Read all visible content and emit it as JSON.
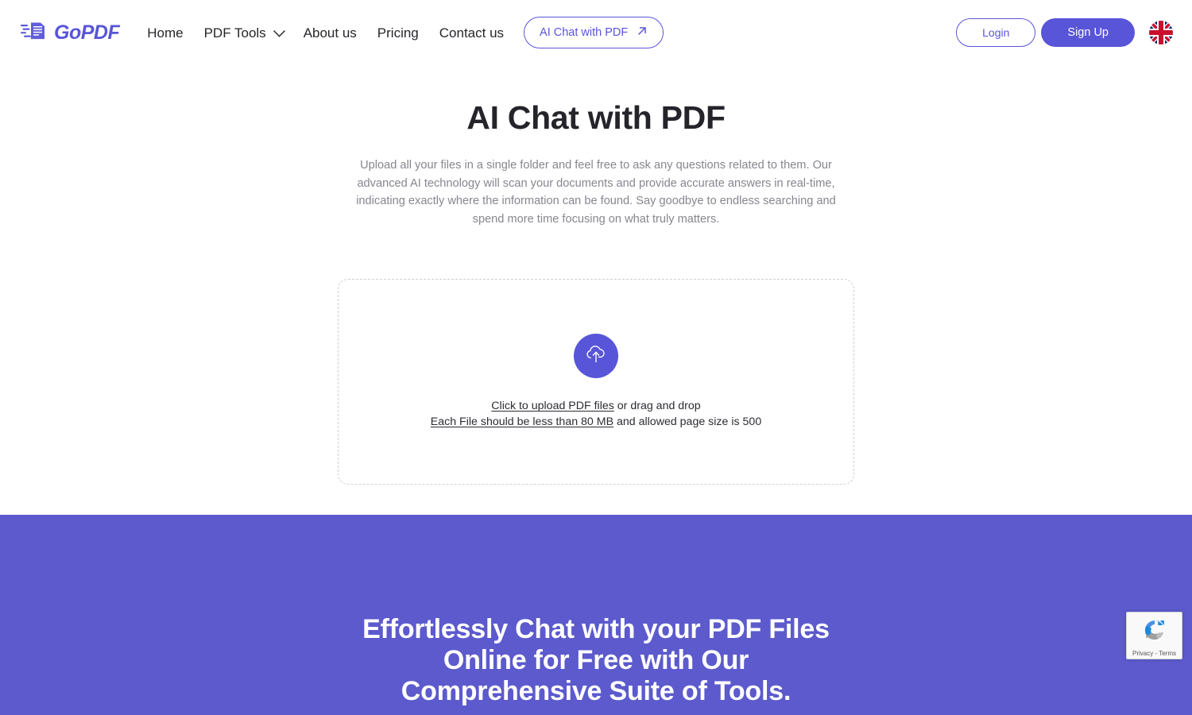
{
  "brand": {
    "name": "GoPDF",
    "logo_icon": "document-motion-logo-icon",
    "color": "#5955D8"
  },
  "header": {
    "nav": [
      {
        "label": "Home",
        "icon": null
      },
      {
        "label": "PDF Tools",
        "icon": "chevron-down-icon"
      },
      {
        "label": "About us",
        "icon": null
      },
      {
        "label": "Pricing",
        "icon": null
      },
      {
        "label": "Contact us",
        "icon": null
      }
    ],
    "nav_pill": {
      "label": "AI Chat with PDF",
      "icon": "arrow-up-right-icon"
    },
    "login_label": "Login",
    "signup_label": "Sign Up",
    "language_flag": "uk-flag-icon"
  },
  "hero": {
    "title": "AI Chat with PDF",
    "description": "Upload all your files in a single folder and feel free to ask any questions related to them. Our advanced AI technology will scan your documents and provide accurate answers in real-time, indicating exactly where the information can be found. Say goodbye to endless searching and spend more time focusing on what truly matters."
  },
  "upload": {
    "icon": "cloud-upload-icon",
    "line1_link": "Click to upload PDF files",
    "line1_rest": " or drag and drop",
    "line2_link": "Each File should be less than 80 MB",
    "line2_rest": " and allowed page size is 500"
  },
  "band": {
    "background": "#5C5ACD",
    "title_line1": "Effortlessly Chat with your PDF Files",
    "title_line2": "Online for Free with Our",
    "title_line3": "Comprehensive Suite of Tools."
  },
  "recaptcha": {
    "icon": "recaptcha-icon",
    "text": "Privacy - Terms"
  }
}
